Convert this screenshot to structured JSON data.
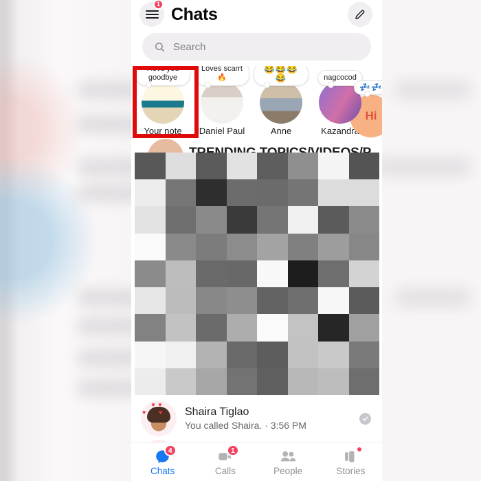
{
  "header": {
    "menu_icon": "hamburger-menu-icon",
    "menu_badge": "1",
    "title": "Chats",
    "compose_icon": "pencil-compose-icon"
  },
  "search": {
    "icon": "search-icon",
    "placeholder": "Search",
    "value": ""
  },
  "notes": [
    {
      "bubble": "I love you goodbye",
      "name": "Your note",
      "avatar": "your-note-avatar",
      "highlighted": true
    },
    {
      "bubble": "Loves scarrt 🔥",
      "name": "Daniel Paul",
      "avatar": "daniel-paul-avatar",
      "highlighted": false
    },
    {
      "bubble": "😂😂😂😂",
      "name": "Anne",
      "avatar": "anne-avatar",
      "highlighted": false
    },
    {
      "bubble": "nagcocod",
      "name": "Kazandra",
      "avatar": "kazandra-avatar",
      "highlighted": false
    }
  ],
  "notes_edge": {
    "bubble": "💤💤",
    "avatar_text": "Hi"
  },
  "content": {
    "trending_text": "TRENDING TOPICS/VIDEOS/P",
    "censored": true,
    "mosaic": {
      "cols": 8,
      "rows": 9,
      "cells": [
        "#585858",
        "#dedede",
        "#5a5a5a",
        "#e2e2e2",
        "#5e5e5e",
        "#8f8f8f",
        "#f4f4f4",
        "#545454",
        "#ededed",
        "#767676",
        "#2e2e2e",
        "#6c6c6c",
        "#6b6b6b",
        "#757575",
        "#dcdcdc",
        "#dcdcdc",
        "#e3e3e3",
        "#6f6f6f",
        "#8a8a8a",
        "#3a3a3a",
        "#757575",
        "#f1f1f1",
        "#5b5b5b",
        "#8b8b8b",
        "#fafafa",
        "#8a8a8a",
        "#7c7c7c",
        "#8c8c8c",
        "#a3a3a3",
        "#808080",
        "#9d9d9d",
        "#878787",
        "#8b8b8b",
        "#bdbdbd",
        "#6a6a6a",
        "#686868",
        "#f8f8f8",
        "#1d1d1d",
        "#6e6e6e",
        "#d3d3d3",
        "#e6e6e6",
        "#bcbcbc",
        "#888888",
        "#8e8e8e",
        "#636363",
        "#6f6f6f",
        "#f7f7f7",
        "#5b5b5b",
        "#828282",
        "#c2c2c2",
        "#6b6b6b",
        "#adadad",
        "#fafafa",
        "#c3c3c3",
        "#262626",
        "#a0a0a0",
        "#f6f6f6",
        "#f0f0f0",
        "#b3b3b3",
        "#696969",
        "#5d5d5d",
        "#c2c2c2",
        "#c9c9c9",
        "#7a7a7a",
        "#ececec",
        "#c9c9c9",
        "#a7a7a7",
        "#737373",
        "#5f5f5f",
        "#b8b8b8",
        "#bdbdbd",
        "#6e6e6e"
      ]
    }
  },
  "chat": {
    "avatar": "shaira-tiglao-avatar",
    "name": "Shaira Tiglao",
    "snippet": "You called Shaira.  ·  3:56 PM",
    "status_icon": "seen-check-icon"
  },
  "bottom_nav": [
    {
      "label": "Chats",
      "icon": "chat-bubble-icon",
      "badge": "4",
      "dot": false,
      "active": true
    },
    {
      "label": "Calls",
      "icon": "video-call-icon",
      "badge": "1",
      "dot": false,
      "active": false
    },
    {
      "label": "People",
      "icon": "people-icon",
      "badge": "",
      "dot": false,
      "active": false
    },
    {
      "label": "Stories",
      "icon": "stories-icon",
      "badge": "",
      "dot": true,
      "active": false
    }
  ],
  "colors": {
    "accent_blue": "#1778f2",
    "badge_red": "#f3425f",
    "highlight_red": "#e10a0a",
    "text_primary": "#1c1e21",
    "text_secondary": "#65676b"
  }
}
